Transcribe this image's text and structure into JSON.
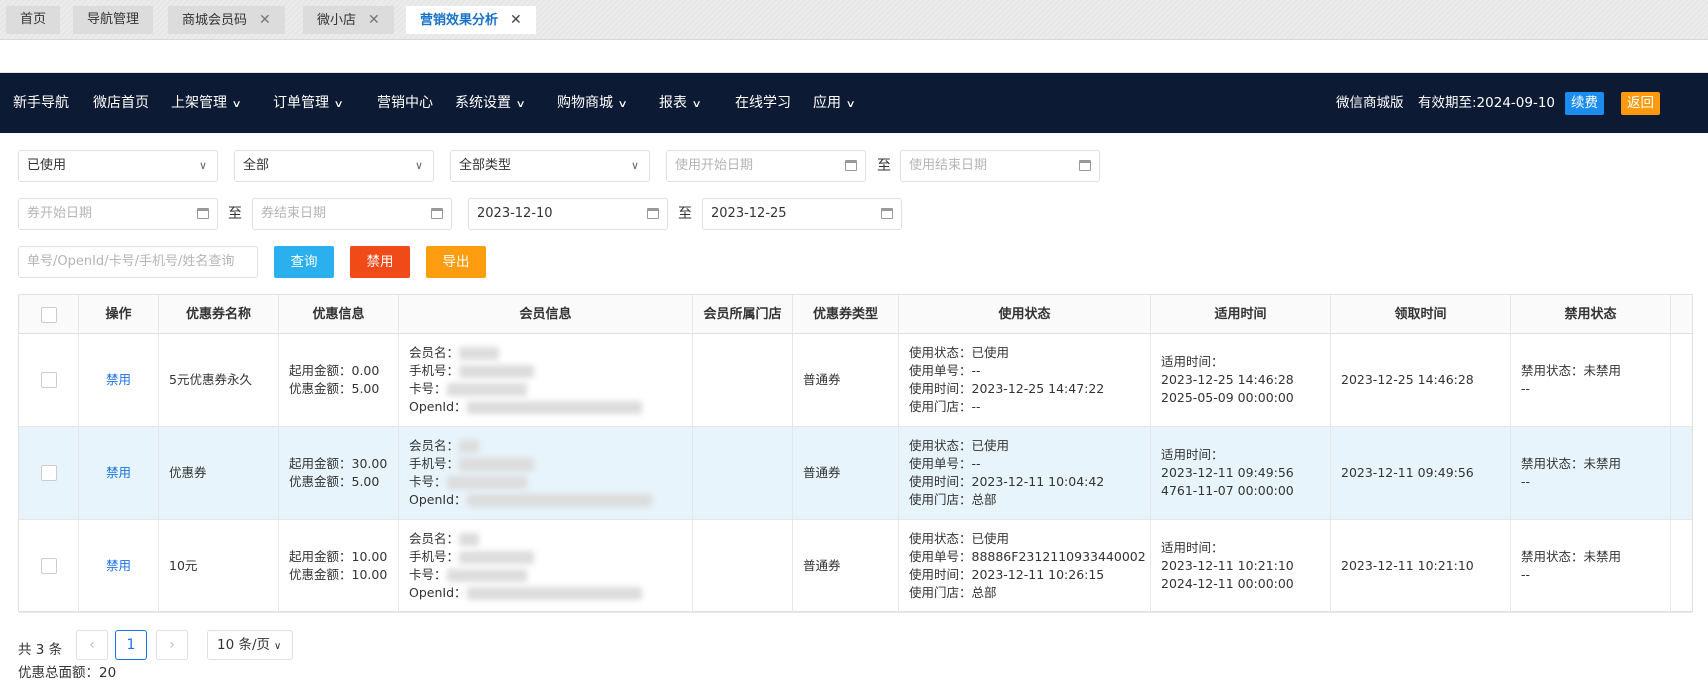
{
  "tabs": [
    {
      "label": "首页",
      "closable": false,
      "active": false
    },
    {
      "label": "导航管理",
      "closable": false,
      "active": false
    },
    {
      "label": "商城会员码",
      "closable": true,
      "active": false
    },
    {
      "label": "微小店",
      "closable": true,
      "active": false
    },
    {
      "label": "营销效果分析",
      "closable": true,
      "active": true
    }
  ],
  "close_glyph": "✕",
  "nav": {
    "items": [
      {
        "label": "新手导航",
        "dropdown": false
      },
      {
        "label": "微店首页",
        "dropdown": false
      },
      {
        "label": "上架管理",
        "dropdown": true
      },
      {
        "label": "订单管理",
        "dropdown": true
      },
      {
        "label": "营销中心",
        "dropdown": false
      },
      {
        "label": "系统设置",
        "dropdown": true
      },
      {
        "label": "购物商城",
        "dropdown": true
      },
      {
        "label": "报表",
        "dropdown": true
      },
      {
        "label": "在线学习",
        "dropdown": false
      },
      {
        "label": "应用",
        "dropdown": true
      }
    ],
    "edition": "微信商城版",
    "expiry": "有效期至:2024-09-10",
    "renew_label": "续费",
    "back_label": "返回",
    "colors": {
      "bar": "#0d1a33",
      "renew": "#1b8cf0",
      "back": "#ff9a0e"
    }
  },
  "filters": {
    "status_select": "已使用",
    "scope_select": "全部",
    "type_select": "全部类型",
    "use_start_placeholder": "使用开始日期",
    "use_end_placeholder": "使用结束日期",
    "coupon_start_placeholder": "券开始日期",
    "coupon_end_placeholder": "券结束日期",
    "receive_start": "2023-12-10",
    "receive_end": "2023-12-25",
    "to_label": "至",
    "search_placeholder": "单号/OpenId/卡号/手机号/姓名查询",
    "query_label": "查询",
    "ban_label": "禁用",
    "export_label": "导出"
  },
  "table": {
    "headers": [
      "操作",
      "优惠券名称",
      "优惠信息",
      "会员信息",
      "会员所属门店",
      "优惠券类型",
      "使用状态",
      "适用时间",
      "领取时间",
      "禁用状态"
    ],
    "rows": [
      {
        "action": "禁用",
        "coupon_name": "5元优惠券永久",
        "discount": {
          "min": "起用金额：0.00",
          "amount": "优惠金额：5.00"
        },
        "member": {
          "name": "会员名：",
          "phone": "手机号：",
          "card": "卡号：",
          "openid": "OpenId："
        },
        "store": "",
        "type": "普通券",
        "use": {
          "status": "使用状态：已使用",
          "order": "使用单号：--",
          "time": "使用时间：2023-12-25 14:47:22",
          "store": "使用门店：--"
        },
        "valid": {
          "label": "适用时间：",
          "start": "2023-12-25 14:46:28",
          "end": "2025-05-09 00:00:00"
        },
        "received": "2023-12-25 14:46:28",
        "ban": {
          "status": "禁用状态：未禁用",
          "extra": "--"
        },
        "highlight": false
      },
      {
        "action": "禁用",
        "coupon_name": "优惠券",
        "discount": {
          "min": "起用金额：30.00",
          "amount": "优惠金额：5.00"
        },
        "member": {
          "name": "会员名：",
          "phone": "手机号：",
          "card": "卡号：",
          "openid": "OpenId："
        },
        "store": "",
        "type": "普通券",
        "use": {
          "status": "使用状态：已使用",
          "order": "使用单号：--",
          "time": "使用时间：2023-12-11 10:04:42",
          "store": "使用门店：总部"
        },
        "valid": {
          "label": "适用时间：",
          "start": "2023-12-11 09:49:56",
          "end": "4761-11-07 00:00:00"
        },
        "received": "2023-12-11 09:49:56",
        "ban": {
          "status": "禁用状态：未禁用",
          "extra": "--"
        },
        "highlight": true
      },
      {
        "action": "禁用",
        "coupon_name": "10元",
        "discount": {
          "min": "起用金额：10.00",
          "amount": "优惠金额：10.00"
        },
        "member": {
          "name": "会员名：",
          "phone": "手机号：",
          "card": "卡号：",
          "openid": "OpenId："
        },
        "store": "",
        "type": "普通券",
        "use": {
          "status": "使用状态：已使用",
          "order": "使用单号：88886F2312110933440002",
          "time": "使用时间：2023-12-11 10:26:15",
          "store": "使用门店：总部"
        },
        "valid": {
          "label": "适用时间：",
          "start": "2023-12-11 10:21:10",
          "end": "2024-12-11 00:00:00"
        },
        "received": "2023-12-11 10:21:10",
        "ban": {
          "status": "禁用状态：未禁用",
          "extra": "--"
        },
        "highlight": false
      }
    ]
  },
  "pagination": {
    "total": "共 3 条",
    "prev": "‹",
    "page": "1",
    "next": "›",
    "page_size": "10 条/页"
  },
  "summary": "优惠总面额：20"
}
